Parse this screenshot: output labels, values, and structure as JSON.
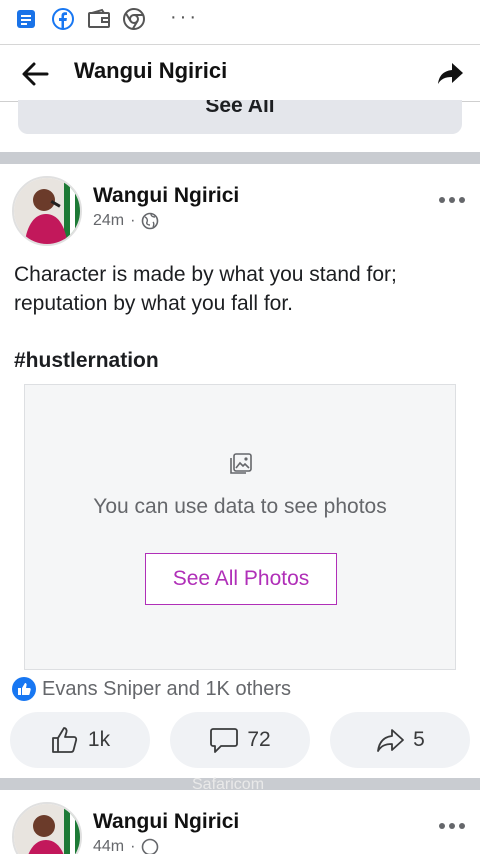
{
  "statusbar": {
    "icons": [
      "docs-icon",
      "facebook-icon",
      "wallet-icon",
      "chrome-icon"
    ],
    "overflow": "···"
  },
  "topbar": {
    "title": "Wangui Ngirici"
  },
  "previous_section": {
    "see_all_label": "See All"
  },
  "post": {
    "author": "Wangui Ngirici",
    "time": "24m",
    "text": "Character is made by what you stand for; reputation by what you fall for.",
    "hashtag": "#hustlernation",
    "media_placeholder": {
      "message": "You can use data to see photos",
      "button_label": "See All Photos"
    },
    "reactions_text": "Evans Sniper and 1K others",
    "actions": {
      "likes": "1k",
      "comments": "72",
      "shares": "5"
    }
  },
  "carrier_watermark": "Safaricom",
  "next_post": {
    "author": "Wangui Ngirici",
    "time": "44m"
  },
  "colors": {
    "accent_link": "#b02fb8",
    "facebook_blue": "#1877f2",
    "separator": "#c9ccd1"
  }
}
